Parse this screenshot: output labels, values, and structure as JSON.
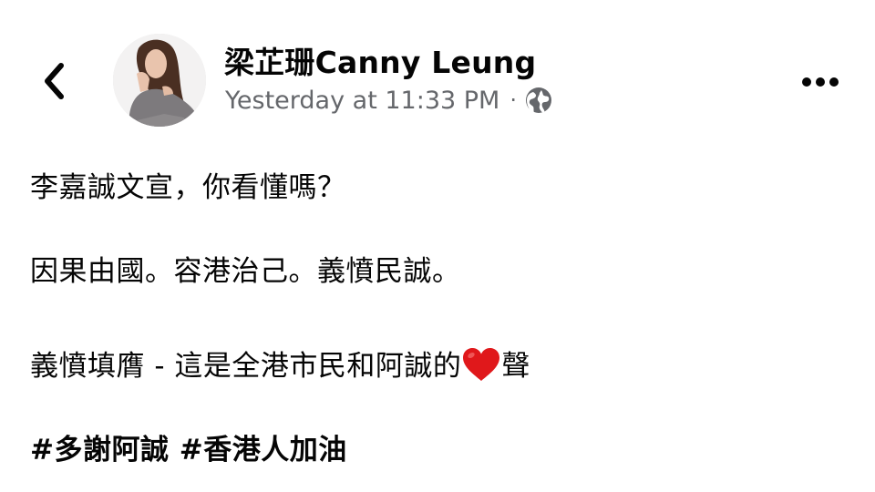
{
  "header": {
    "author_name": "梁芷珊Canny Leung",
    "timestamp": "Yesterday at 11:33 PM",
    "separator": "·",
    "privacy_icon": "globe-icon",
    "back_icon": "chevron-left-icon",
    "more_icon": "more-options-icon",
    "secondary_color": "#65676b"
  },
  "post": {
    "line1": "李嘉誠文宣，你看懂嗎？",
    "line2": "因果由國。容港治己。義憤民誠。",
    "line3_before": "義憤填膺 - 這是全港市民和阿誠的",
    "line3_emoji": "heart-emoji",
    "line3_after": "聲",
    "hashtags": [
      "#多謝阿誠",
      "#香港人加油"
    ]
  },
  "colors": {
    "text": "#050505",
    "heart": "#e0181b",
    "background": "#ffffff"
  }
}
